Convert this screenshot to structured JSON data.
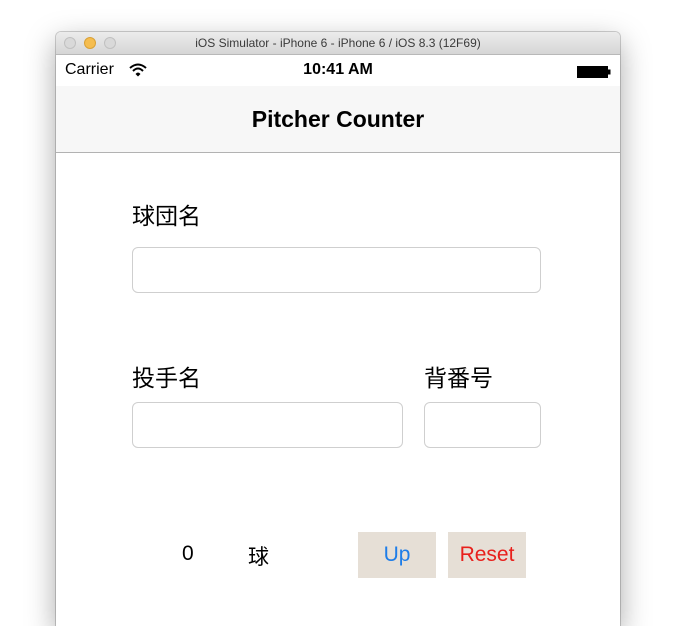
{
  "window": {
    "title": "iOS Simulator - iPhone 6 - iPhone 6 / iOS 8.3 (12F69)"
  },
  "status_bar": {
    "carrier": "Carrier",
    "time": "10:41 AM",
    "wifi_icon": "wifi-icon",
    "battery_icon": "battery-icon"
  },
  "nav": {
    "title": "Pitcher Counter"
  },
  "form": {
    "team_label": "球団名",
    "team_value": "",
    "pitcher_label": "投手名",
    "pitcher_value": "",
    "number_label": "背番号",
    "number_value": ""
  },
  "counter": {
    "count": "0",
    "unit": "球",
    "up_label": "Up",
    "reset_label": "Reset"
  },
  "colors": {
    "button_background": "#e6dfd6",
    "up_text": "#1e7de8",
    "reset_text": "#e8201c",
    "navbar_background": "#f7f7f7"
  }
}
